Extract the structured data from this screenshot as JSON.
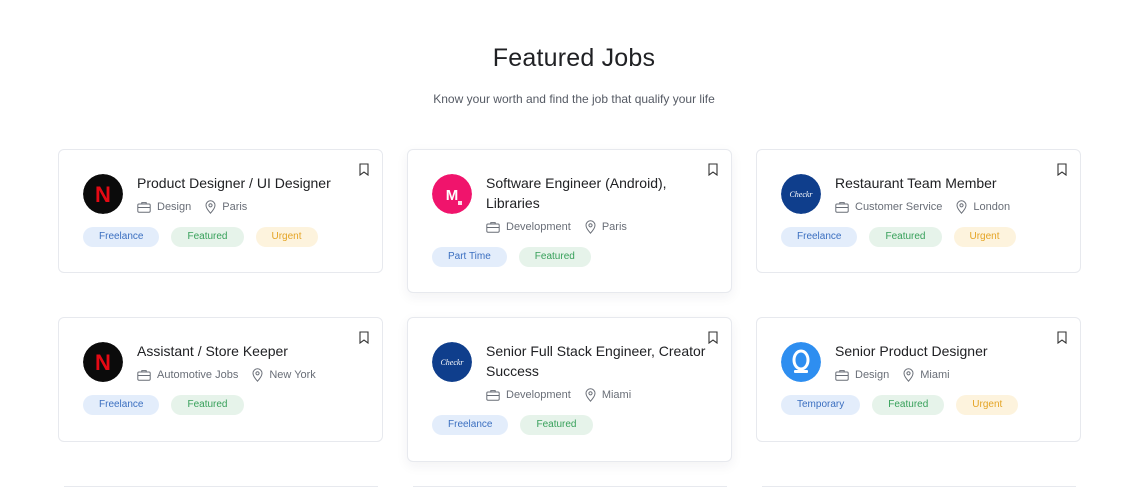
{
  "section": {
    "title": "Featured Jobs",
    "subtitle": "Know your worth and find the job that qualify your life"
  },
  "jobs": [
    {
      "title": "Product Designer / UI Designer",
      "logo": "netflix-logo",
      "logo_text": "N",
      "category": "Design",
      "location": "Paris",
      "tags": [
        {
          "label": "Freelance",
          "color": "blue"
        },
        {
          "label": "Featured",
          "color": "green"
        },
        {
          "label": "Urgent",
          "color": "yellow"
        }
      ]
    },
    {
      "title": "Software Engineer (Android), Libraries",
      "logo": "m-logo",
      "logo_text": "M",
      "category": "Development",
      "location": "Paris",
      "tags": [
        {
          "label": "Part Time",
          "color": "blue"
        },
        {
          "label": "Featured",
          "color": "green"
        }
      ]
    },
    {
      "title": "Restaurant Team Member",
      "logo": "checkr-logo",
      "logo_text": "Checkr",
      "category": "Customer Service",
      "location": "London",
      "tags": [
        {
          "label": "Freelance",
          "color": "blue"
        },
        {
          "label": "Featured",
          "color": "green"
        },
        {
          "label": "Urgent",
          "color": "yellow"
        }
      ]
    },
    {
      "title": "Assistant / Store Keeper",
      "logo": "netflix-logo",
      "logo_text": "N",
      "category": "Automotive Jobs",
      "location": "New York",
      "tags": [
        {
          "label": "Freelance",
          "color": "blue"
        },
        {
          "label": "Featured",
          "color": "green"
        }
      ]
    },
    {
      "title": "Senior Full Stack Engineer, Creator Success",
      "logo": "checkr-logo",
      "logo_text": "Checkr",
      "category": "Development",
      "location": "Miami",
      "tags": [
        {
          "label": "Freelance",
          "color": "blue"
        },
        {
          "label": "Featured",
          "color": "green"
        }
      ]
    },
    {
      "title": "Senior Product Designer",
      "logo": "q-logo",
      "logo_text": "Q",
      "category": "Design",
      "location": "Miami",
      "tags": [
        {
          "label": "Temporary",
          "color": "blue"
        },
        {
          "label": "Featured",
          "color": "green"
        },
        {
          "label": "Urgent",
          "color": "yellow"
        }
      ]
    }
  ],
  "colors": {
    "netflix_bg": "#0b0b0b",
    "netflix_red": "#e50914",
    "m_bg": "#f0146c",
    "checkr_bg": "#0f3e8c",
    "q_bg": "#2e8ef0"
  }
}
